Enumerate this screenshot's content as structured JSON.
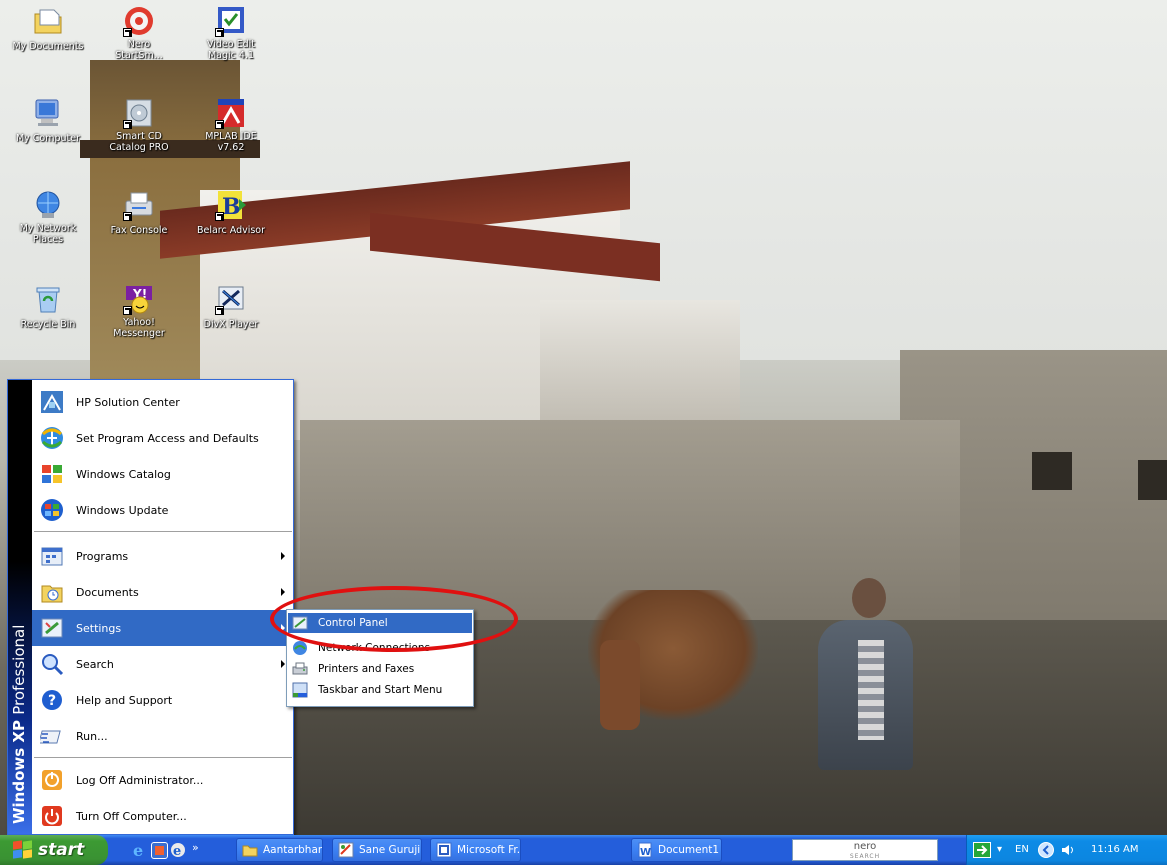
{
  "desktop": {
    "icons": [
      {
        "label": "My Documents",
        "icon": "my-documents-icon"
      },
      {
        "label": "Nero StartSm...",
        "icon": "nero-startsmart-icon"
      },
      {
        "label": "Video Edit Magic 4.1",
        "icon": "video-edit-magic-icon"
      },
      {
        "label": "My Computer",
        "icon": "my-computer-icon"
      },
      {
        "label": "Smart CD Catalog PRO",
        "icon": "smart-cd-catalog-icon"
      },
      {
        "label": "MPLAB IDE v7.62",
        "icon": "mplab-ide-icon"
      },
      {
        "label": "My Network Places",
        "icon": "network-places-icon"
      },
      {
        "label": "Fax Console",
        "icon": "fax-console-icon"
      },
      {
        "label": "Belarc Advisor",
        "icon": "belarc-advisor-icon"
      },
      {
        "label": "Recycle Bin",
        "icon": "recycle-bin-icon"
      },
      {
        "label": "Yahoo! Messenger",
        "icon": "yahoo-messenger-icon"
      },
      {
        "label": "DivX Player",
        "icon": "divx-player-icon"
      }
    ]
  },
  "start_menu": {
    "banner_bold": "Windows XP",
    "banner_light": "Professional",
    "items": [
      {
        "label": "HP Solution Center",
        "icon": "hp-solution-center-icon"
      },
      {
        "label": "Set Program Access and Defaults",
        "icon": "program-access-icon"
      },
      {
        "label": "Windows Catalog",
        "icon": "windows-catalog-icon"
      },
      {
        "label": "Windows Update",
        "icon": "windows-update-icon"
      },
      {
        "label": "Programs",
        "icon": "programs-icon"
      },
      {
        "label": "Documents",
        "icon": "documents-icon"
      },
      {
        "label": "Settings",
        "icon": "settings-icon"
      },
      {
        "label": "Search",
        "icon": "search-icon"
      },
      {
        "label": "Help and Support",
        "icon": "help-icon"
      },
      {
        "label": "Run...",
        "icon": "run-icon"
      },
      {
        "label": "Log Off Administrator...",
        "icon": "log-off-icon"
      },
      {
        "label": "Turn Off Computer...",
        "icon": "power-icon"
      }
    ]
  },
  "settings_submenu": {
    "items": [
      {
        "label": "Control Panel",
        "icon": "control-panel-icon"
      },
      {
        "label": "Network Connections",
        "icon": "network-connections-icon"
      },
      {
        "label": "Printers and Faxes",
        "icon": "printers-icon"
      },
      {
        "label": "Taskbar and Start Menu",
        "icon": "taskbar-settings-icon"
      }
    ]
  },
  "taskbar": {
    "start_label": "start",
    "quick_launch_more": "»",
    "buttons": [
      {
        "label": "Aantarbhar...",
        "icon": "folder-icon"
      },
      {
        "label": "Sane Guruji ...",
        "icon": "paint-icon"
      },
      {
        "label": "Microsoft Fr...",
        "icon": "frontpage-icon"
      },
      {
        "label": "Document1 -...",
        "icon": "word-icon"
      }
    ],
    "search_box": {
      "brand": "nero",
      "caption": "SEARCH"
    },
    "tray": {
      "language": "EN",
      "time": "11:16 AM"
    }
  },
  "colors": {
    "selection": "#316ac5",
    "taskbar": "#245edb",
    "start_button": "#3c9a33",
    "tray": "#0c86e0",
    "annotation": "#e01010"
  }
}
